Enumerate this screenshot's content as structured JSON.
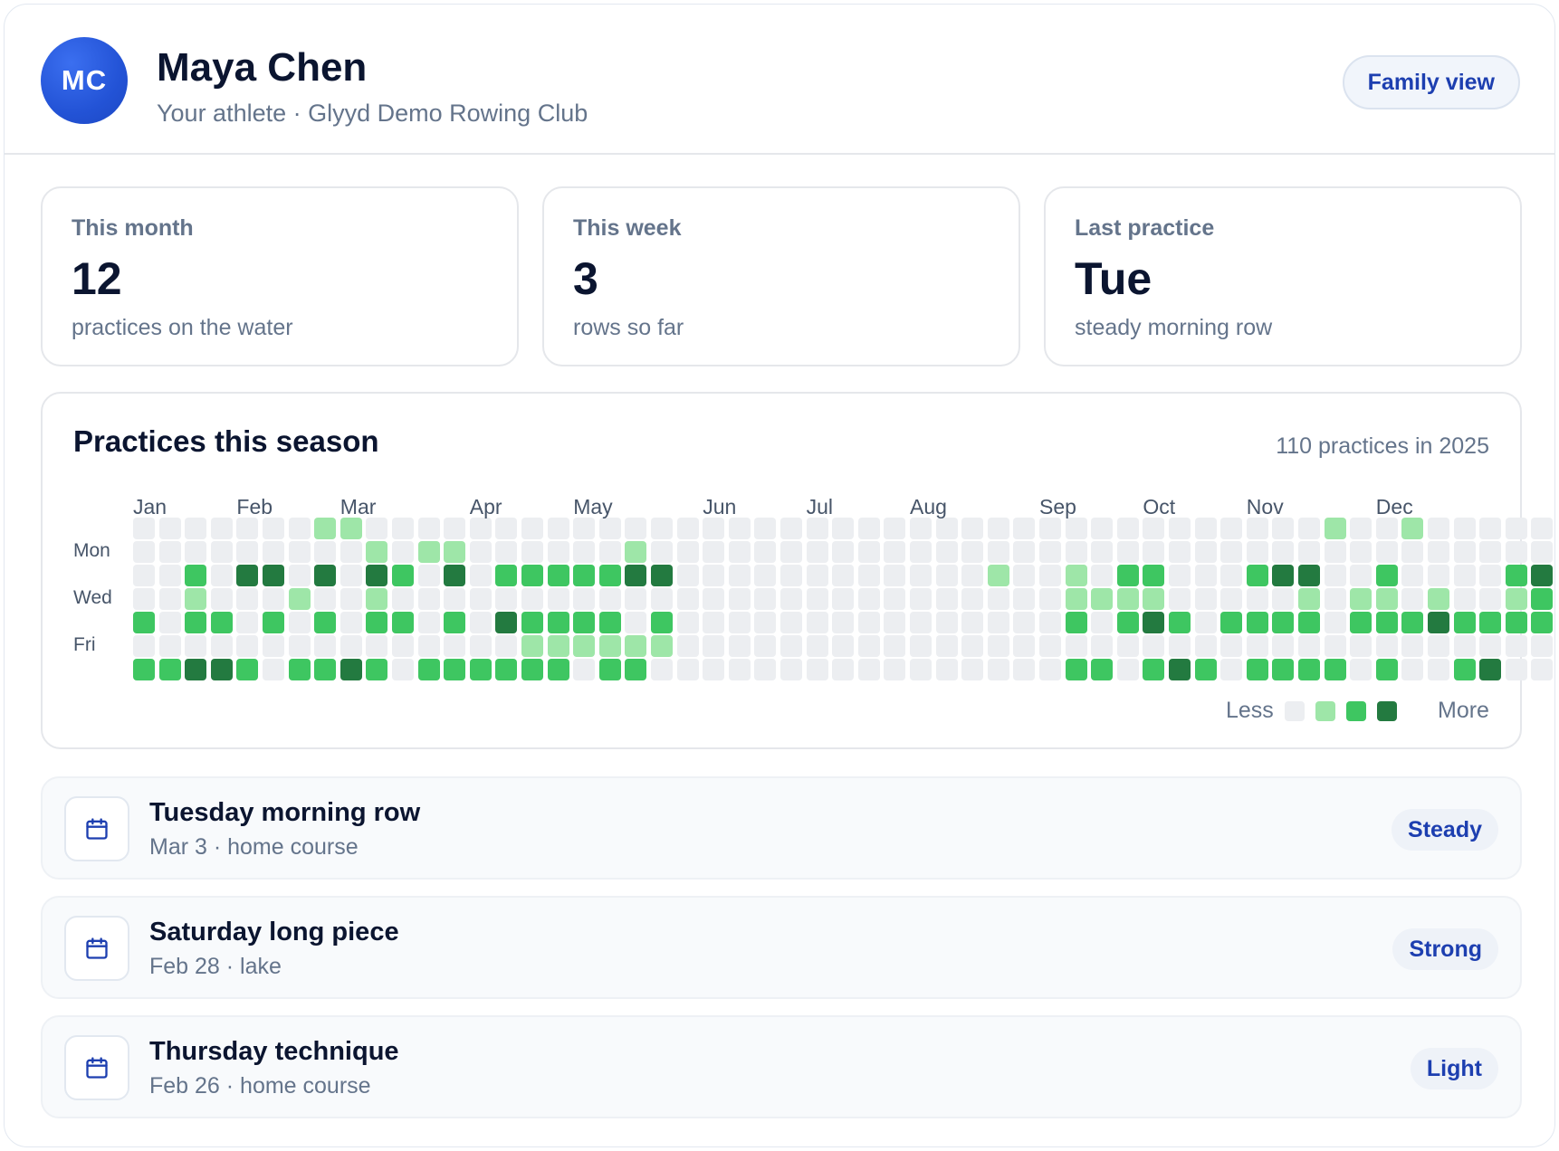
{
  "athlete": {
    "initials": "MC",
    "name": "Maya Chen",
    "subtitle": "Your athlete · Glyyd Demo Rowing Club",
    "view_button": "Family view"
  },
  "stats": [
    {
      "label": "This month",
      "value": "12",
      "note": "practices on the water"
    },
    {
      "label": "This week",
      "value": "3",
      "note": "rows so far"
    },
    {
      "label": "Last practice",
      "value": "Tue",
      "note": "steady morning row"
    }
  ],
  "heatmap": {
    "title": "Practices this season",
    "total": "110 practices in 2025",
    "months": [
      "Jan",
      "Feb",
      "Mar",
      "Apr",
      "May",
      "Jun",
      "Jul",
      "Aug",
      "Sep",
      "Oct",
      "Nov",
      "Dec"
    ],
    "month_start_weeks": [
      0,
      4,
      8,
      13,
      17,
      22,
      26,
      30,
      35,
      39,
      43,
      48
    ],
    "day_labels": [
      {
        "row": 1,
        "text": "Mon"
      },
      {
        "row": 3,
        "text": "Wed"
      },
      {
        "row": 5,
        "text": "Fri"
      }
    ],
    "levels": [
      "0000000110000000000000000000000000000000000000100100000",
      "0000000001011000000100000000000000000000000000000000000",
      "0020330303203022222330000000000001001022000233002000023",
      "0010001001000000000000000000000000001111000001011010012",
      "2022020202202032222020000000000000002023202222022232222",
      "0000000000000001111110000000000000000000000000000000000",
      "2233202232022222202200000000000000002202320222202002300"
    ],
    "legend": {
      "less": "Less",
      "more": "More"
    },
    "colors": [
      "#eceef1",
      "#9ee6a8",
      "#3ec661",
      "#237a40"
    ]
  },
  "sessions": [
    {
      "title": "Tuesday morning row",
      "sub": "Mar 3 · home course",
      "badge": "Steady",
      "icon": "calendar-icon"
    },
    {
      "title": "Saturday long piece",
      "sub": "Feb 28 · lake",
      "badge": "Strong",
      "icon": "calendar-icon"
    },
    {
      "title": "Thursday technique",
      "sub": "Feb 26 · home course",
      "badge": "Light",
      "icon": "calendar-icon"
    }
  ]
}
